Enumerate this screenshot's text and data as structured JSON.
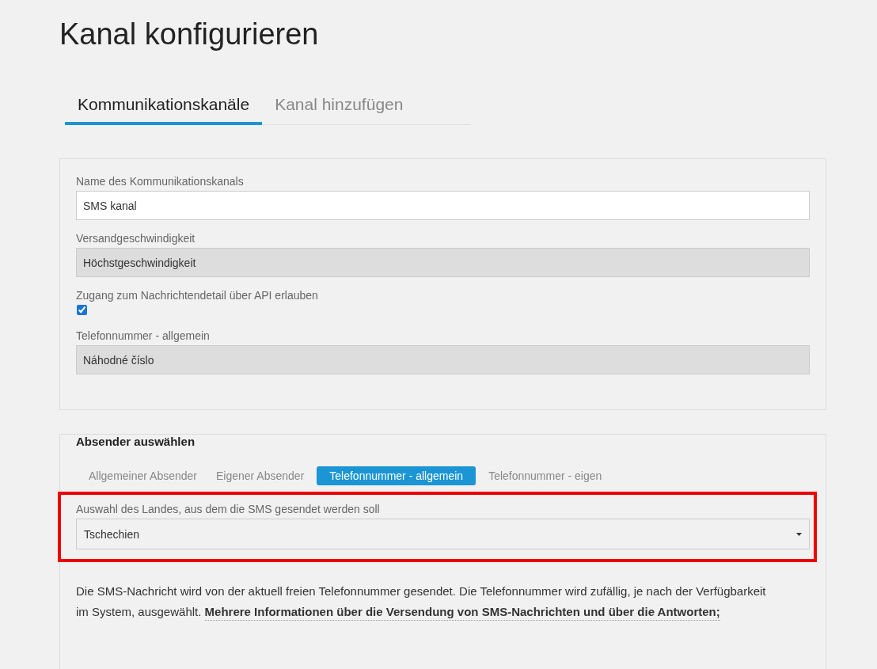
{
  "title": "Kanal konfigurieren",
  "tabs": [
    {
      "label": "Kommunikationskanäle",
      "selected": true
    },
    {
      "label": "Kanal hinzufügen",
      "selected": false
    }
  ],
  "channel_form": {
    "name_field": {
      "label": "Name des Kommunikationskanals",
      "value": "SMS kanal",
      "disabled": false
    },
    "speed_field": {
      "label": "Versandgeschwindigkeit",
      "value": "Höchstgeschwindigkeit",
      "disabled": true
    },
    "api_access": {
      "label": "Zugang zum Nachrichtendetail über API erlauben",
      "checked": true
    },
    "phone_field": {
      "label": "Telefonnummer - allgemein",
      "value": "Náhodné číslo",
      "disabled": true
    }
  },
  "sender": {
    "legend": "Absender auswählen",
    "options": [
      {
        "label": "Allgemeiner Absender",
        "selected": false
      },
      {
        "label": "Eigener Absender",
        "selected": false
      },
      {
        "label": "Telefonnummer - allgemein",
        "selected": true
      },
      {
        "label": "Telefonnummer - eigen",
        "selected": false
      }
    ],
    "country": {
      "label": "Auswahl des Landes, aus dem die SMS gesendet werden soll",
      "value": "Tschechien",
      "highlighted": true
    },
    "info_text": "Die SMS-Nachricht wird von der aktuell freien Telefonnummer gesendet. Die Telefonnummer wird zufällig, je nach der Verfügbarkeit im System, ausgewählt.",
    "info_link": "Mehrere Informationen über die Versendung von SMS-Nachrichten und über die Antworten;"
  }
}
